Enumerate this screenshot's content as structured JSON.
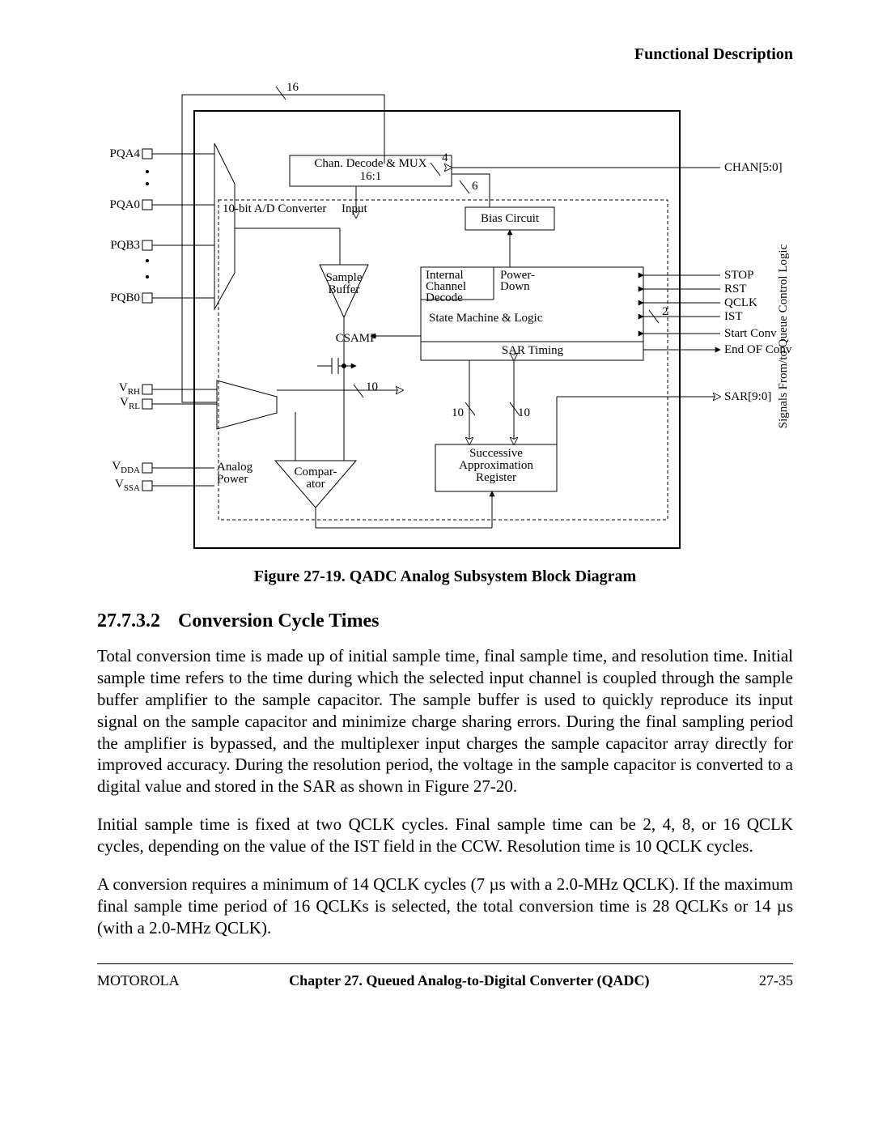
{
  "header": {
    "running_head": "Functional Description"
  },
  "figure": {
    "caption": "Figure 27-19. QADC Analog Subsystem Block Diagram",
    "bus_widths": {
      "top": "16",
      "chan_hi": "4",
      "chan_lo": "6",
      "ist": "2",
      "dac": "10",
      "sar_a": "10",
      "sar_b": "10"
    },
    "pins_left": {
      "pqa4": "PQA4",
      "pqa0": "PQA0",
      "pqb3": "PQB3",
      "pqb0": "PQB0",
      "vrh": "V",
      "vrh_sub": "RH",
      "vrl": "V",
      "vrl_sub": "RL",
      "vdda": "V",
      "vdda_sub": "DDA",
      "vssa": "V",
      "vssa_sub": "SSA"
    },
    "blocks": {
      "mux_line1": "Chan. Decode & MUX",
      "mux_line2": "16:1",
      "adc": "10-bit A/D Converter",
      "input": "Input",
      "bias": "Bias Circuit",
      "sample_line1": "Sample",
      "sample_line2": "Buffer",
      "csamp": "CSAMP",
      "int_ch1": "Internal",
      "int_ch2": "Channel",
      "int_ch3": "Decode",
      "pd1": "Power-",
      "pd2": "Down",
      "sm": "State Machine & Logic",
      "sar_timing": "SAR Timing",
      "analog1": "Analog",
      "analog2": "Power",
      "comp1": "Compar-",
      "comp2": "ator",
      "sar_reg1": "Successive",
      "sar_reg2": "Approximation",
      "sar_reg3": "Register"
    },
    "right_signals": {
      "chan": "CHAN[5:0]",
      "stop": "STOP",
      "rst": "RST",
      "qclk": "QCLK",
      "ist": "IST",
      "start": "Start Conv",
      "end": "End OF Conv",
      "sar": "SAR[9:0]",
      "group": "Signals From/to Queue Control Logic"
    }
  },
  "section": {
    "number": "27.7.3.2",
    "title": "Conversion Cycle Times",
    "p1": "Total conversion time is made up of initial sample time, final sample time, and resolution time. Initial sample time refers to the time during which the selected input channel is coupled through the sample buffer amplifier to the sample capacitor. The sample buffer is used to quickly reproduce its input signal on the sample capacitor and minimize charge sharing errors. During the final sampling period the amplifier is bypassed, and the multiplexer input charges the sample capacitor array directly for improved accuracy. During the resolution period, the voltage in the sample capacitor is converted to a digital value and stored in the SAR as shown in Figure 27-20.",
    "p2": "Initial sample time is fixed at two QCLK cycles. Final sample time can be 2, 4, 8, or 16 QCLK cycles, depending on the value of the IST field in the CCW. Resolution time is 10 QCLK cycles.",
    "p3": "A conversion requires a minimum of 14 QCLK cycles (7 µs with a 2.0-MHz QCLK). If the maximum final sample time period of 16 QCLKs is selected, the total conversion time is 28 QCLKs or 14 µs (with a 2.0-MHz QCLK)."
  },
  "footer": {
    "left": "MOTOROLA",
    "mid": "Chapter 27.  Queued Analog-to-Digital Converter (QADC)",
    "right": "27-35"
  }
}
